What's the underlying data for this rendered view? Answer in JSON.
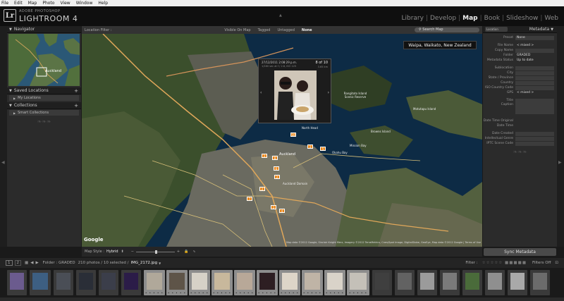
{
  "menubar": {
    "items": [
      "File",
      "Edit",
      "Map",
      "Photo",
      "View",
      "Window",
      "Help"
    ]
  },
  "identity": {
    "brand_small": "ADOBE PHOTOSHOP",
    "brand_big": "LIGHTROOM 4",
    "logo": "Lr"
  },
  "modules": [
    {
      "label": "Library",
      "active": false
    },
    {
      "label": "Develop",
      "active": false
    },
    {
      "label": "Map",
      "active": true
    },
    {
      "label": "Book",
      "active": false
    },
    {
      "label": "Slideshow",
      "active": false
    },
    {
      "label": "Web",
      "active": false
    }
  ],
  "left_panel": {
    "navigator_title": "Navigator",
    "navigator_place": "Auckland",
    "saved_locations_title": "Saved Locations",
    "my_locations": "My Locations",
    "collections_title": "Collections",
    "smart_collections": "Smart Collections"
  },
  "filter_bar": {
    "label": "Location Filter :",
    "options": [
      "Visible On Map",
      "Tagged",
      "Untagged",
      "None"
    ],
    "selected": "None",
    "search_placeholder": "Search Map"
  },
  "map": {
    "location_tooltip": "Waipa, Waikato, New Zealand",
    "google_label": "Google",
    "attribution": "Map data ©2012 Google, Sinclair Knight Merz, Imagery ©2012 TerraMetrics, Cnes/Spot Image, DigitalGlobe, GeoEye, Map data ©2012 Google | Terms of Use",
    "popup": {
      "date": "27/12/2011 2:08:29 p.m.",
      "sub": "1/160 sec at f / 2.8, ISO 125",
      "count": "8 of 10",
      "meta": "3.65 km"
    },
    "place_labels": [
      {
        "text": "Rangitoto Island Scenic Reserve"
      },
      {
        "text": "Auckland"
      },
      {
        "text": "North Head"
      },
      {
        "text": "Auckland Domain"
      },
      {
        "text": "Okahu Bay"
      },
      {
        "text": "Mission Bay"
      },
      {
        "text": "Browns Island"
      },
      {
        "text": "Motutapu Island"
      }
    ],
    "markers": [
      {
        "label": "10"
      },
      {
        "label": "3"
      },
      {
        "label": "8"
      },
      {
        "label": "3"
      },
      {
        "label": "5"
      },
      {
        "label": "6"
      },
      {
        "label": "2"
      },
      {
        "label": "2"
      },
      {
        "label": "7"
      },
      {
        "label": "2"
      },
      {
        "label": "4"
      }
    ]
  },
  "map_toolbar": {
    "style_label": "Map Style :",
    "style_value": "Hybrid"
  },
  "right_panel": {
    "tab_select": "Location",
    "title": "Metadata",
    "preset_label": "Preset",
    "preset_value": "None",
    "rows": [
      {
        "k": "File Name",
        "v": "< mixed >"
      },
      {
        "k": "Copy Name",
        "v": ""
      },
      {
        "k": "Folder",
        "v": "GRADED"
      },
      {
        "k": "Metadata Status",
        "v": "Up to date"
      },
      {
        "k": "Sublocation",
        "v": ""
      },
      {
        "k": "City",
        "v": ""
      },
      {
        "k": "State / Province",
        "v": ""
      },
      {
        "k": "Country",
        "v": ""
      },
      {
        "k": "ISO Country Code",
        "v": ""
      },
      {
        "k": "GPS",
        "v": "< mixed >"
      },
      {
        "k": "Title",
        "v": ""
      },
      {
        "k": "Caption",
        "v": ""
      },
      {
        "k": "Date Time Original",
        "v": ""
      },
      {
        "k": "Date Time",
        "v": ""
      },
      {
        "k": "Date Created",
        "v": ""
      },
      {
        "k": "Intellectual Genre",
        "v": ""
      },
      {
        "k": "IPTC Scene Code",
        "v": ""
      }
    ],
    "sync_button": "Sync Metadata"
  },
  "filmstrip": {
    "page1": "1",
    "page2": "2",
    "path": "Folder : GRADED",
    "count": "210 photos / 10 selected /",
    "filename": "IMG_2172.jpg",
    "filter_label": "Filter :",
    "filters_off": "Filters Off"
  }
}
